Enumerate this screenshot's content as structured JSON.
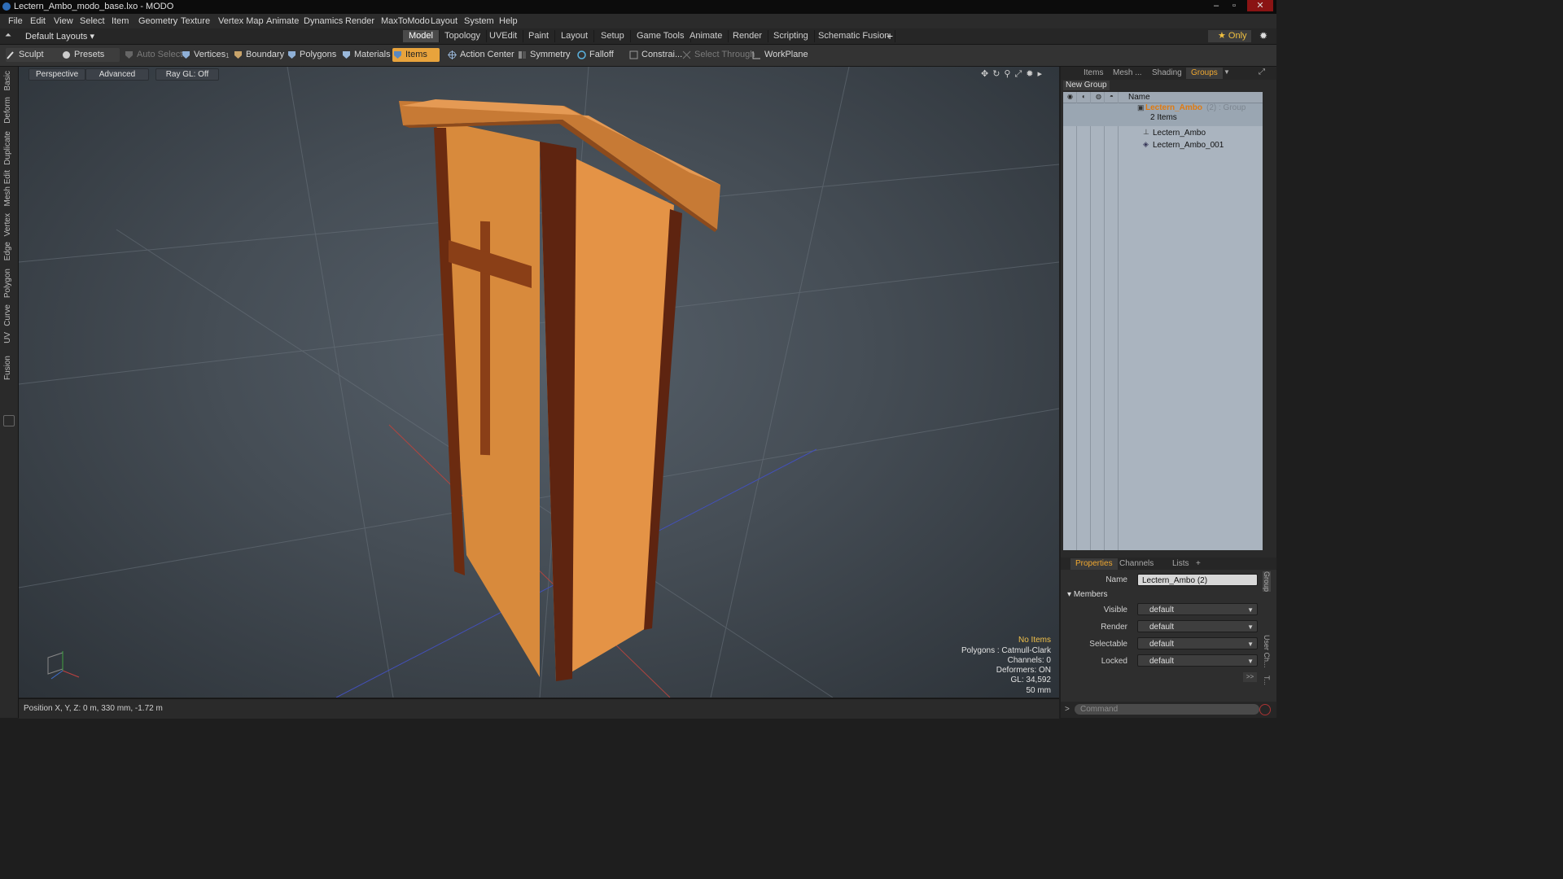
{
  "window": {
    "title": "Lectern_Ambo_modo_base.lxo - MODO",
    "buttons": [
      "–",
      "▫",
      "✕"
    ]
  },
  "menubar": {
    "items": [
      "File",
      "Edit",
      "View",
      "Select",
      "Item",
      "Geometry",
      "Texture",
      "Vertex Map",
      "Animate",
      "Dynamics",
      "Render",
      "MaxToModo",
      "Layout",
      "System",
      "Help"
    ]
  },
  "layouts": {
    "dropdown": "Default Layouts ▾",
    "tabs": [
      "Model",
      "Topology",
      "UVEdit",
      "Paint",
      "Layout",
      "Setup",
      "Game Tools",
      "Animate",
      "Render",
      "Scripting",
      "Schematic Fusion"
    ],
    "active_tab": "Model",
    "add": "+",
    "only": "★  Only",
    "gear": "✹"
  },
  "toolbar": {
    "sculpt": "Sculpt",
    "presets": "Presets",
    "auto_select": "Auto Select",
    "vertices": "Vertices",
    "vertices_badge": "1",
    "boundary": "Boundary",
    "polygons": "Polygons",
    "materials": "Materials",
    "items": "Items",
    "action_center": "Action Center",
    "symmetry": "Symmetry",
    "falloff": "Falloff",
    "constraints": "Constrai...",
    "select_through": "Select Through",
    "workplane": "WorkPlane"
  },
  "left_tabs": [
    "Basic",
    "Deform",
    "Duplicate",
    "Mesh Edit",
    "Vertex",
    "Edge",
    "Polygon",
    "Curve",
    "UV",
    "Fusion"
  ],
  "viewport": {
    "perspective": "Perspective",
    "advanced": "Advanced",
    "raygl": "Ray GL: Off",
    "stats": {
      "no_items": "No Items",
      "polygons": "Polygons : Catmull-Clark",
      "channels": "Channels: 0",
      "deformers": "Deformers: ON",
      "gl": "GL: 34,592",
      "scale": "50 mm"
    }
  },
  "status": {
    "position": "Position X, Y, Z:  0 m, 330 mm, -1.72 m"
  },
  "right_panel": {
    "tabs": [
      "Items",
      "Mesh ...",
      "Shading",
      "Groups"
    ],
    "active_tab": "Groups",
    "new_group": "New Group",
    "col_name": "Name",
    "group_name": "Lectern_Ambo",
    "group_suffix": "(2) : Group",
    "group_count": "2 Items",
    "children": [
      "Lectern_Ambo",
      "Lectern_Ambo_001"
    ]
  },
  "properties": {
    "tabs": [
      "Properties",
      "Channels",
      "Lists",
      "+"
    ],
    "name_label": "Name",
    "name_value": "Lectern_Ambo (2)",
    "section": "Members",
    "fields": [
      {
        "label": "Visible",
        "value": "default"
      },
      {
        "label": "Render",
        "value": "default"
      },
      {
        "label": "Selectable",
        "value": "default"
      },
      {
        "label": "Locked",
        "value": "default"
      }
    ],
    "more": ">>",
    "side_tabs": [
      "Group",
      "User Ch...",
      "T..."
    ],
    "command_placeholder": "Command"
  }
}
